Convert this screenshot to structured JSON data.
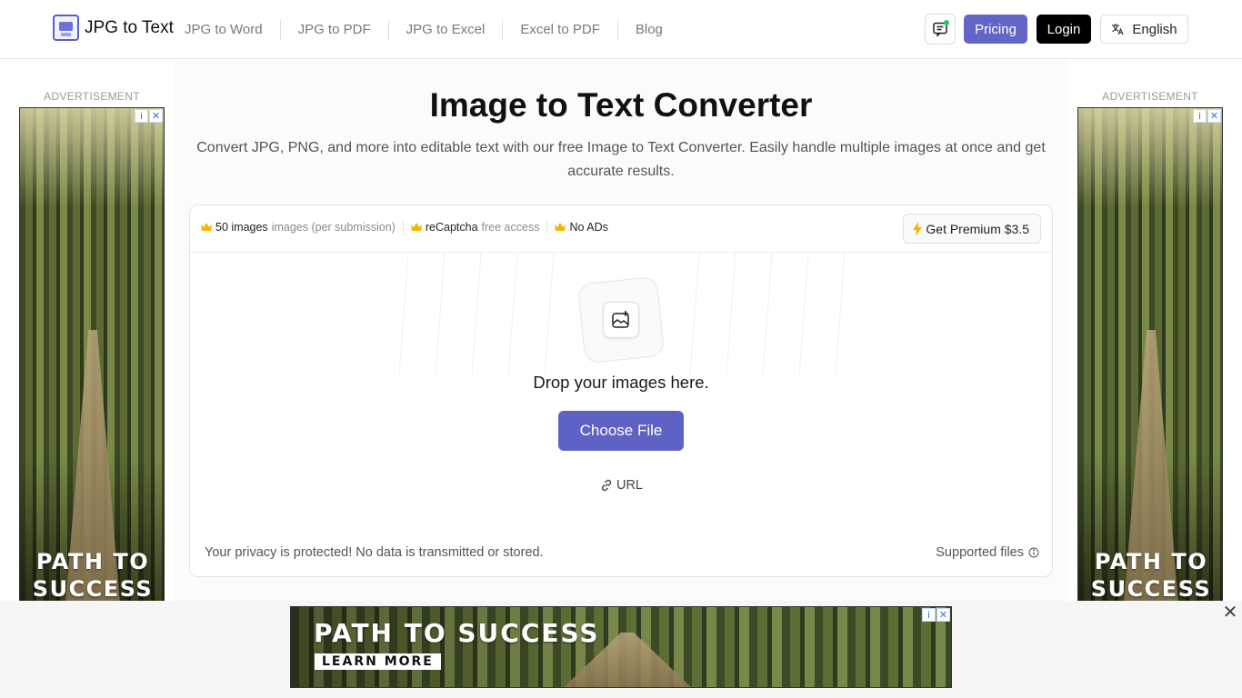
{
  "header": {
    "logo_text": "JPG to Text",
    "nav": [
      "JPG to Word",
      "JPG to PDF",
      "JPG to Excel",
      "Excel to PDF",
      "Blog"
    ],
    "pricing_label": "Pricing",
    "login_label": "Login",
    "language_label": "English"
  },
  "main": {
    "title": "Image to Text Converter",
    "subtitle": "Convert JPG, PNG, and more into editable text with our free Image to Text Converter. Easily handle multiple images at once and get accurate results."
  },
  "upload": {
    "perks": [
      {
        "strong": "50 images",
        "muted": "images (per submission)"
      },
      {
        "strong": "reCaptcha",
        "muted": "free access"
      },
      {
        "strong": "No ADs",
        "muted": ""
      }
    ],
    "premium_label": "Get Premium $3.5",
    "drop_text": "Drop your images here.",
    "choose_label": "Choose File",
    "url_label": "URL",
    "privacy_text": "Your privacy is protected! No data is transmitted or stored.",
    "supported_label": "Supported files"
  },
  "ads": {
    "label": "ADVERTISEMENT",
    "side_headline_line1": "PATH TO",
    "side_headline_line2": "SUCCESS",
    "bottom_headline": "PATH TO SUCCESS",
    "bottom_cta": "LEARN MORE"
  },
  "colors": {
    "accent": "#5f62c5",
    "login_bg": "#000000",
    "status_dot": "#22c55e"
  }
}
